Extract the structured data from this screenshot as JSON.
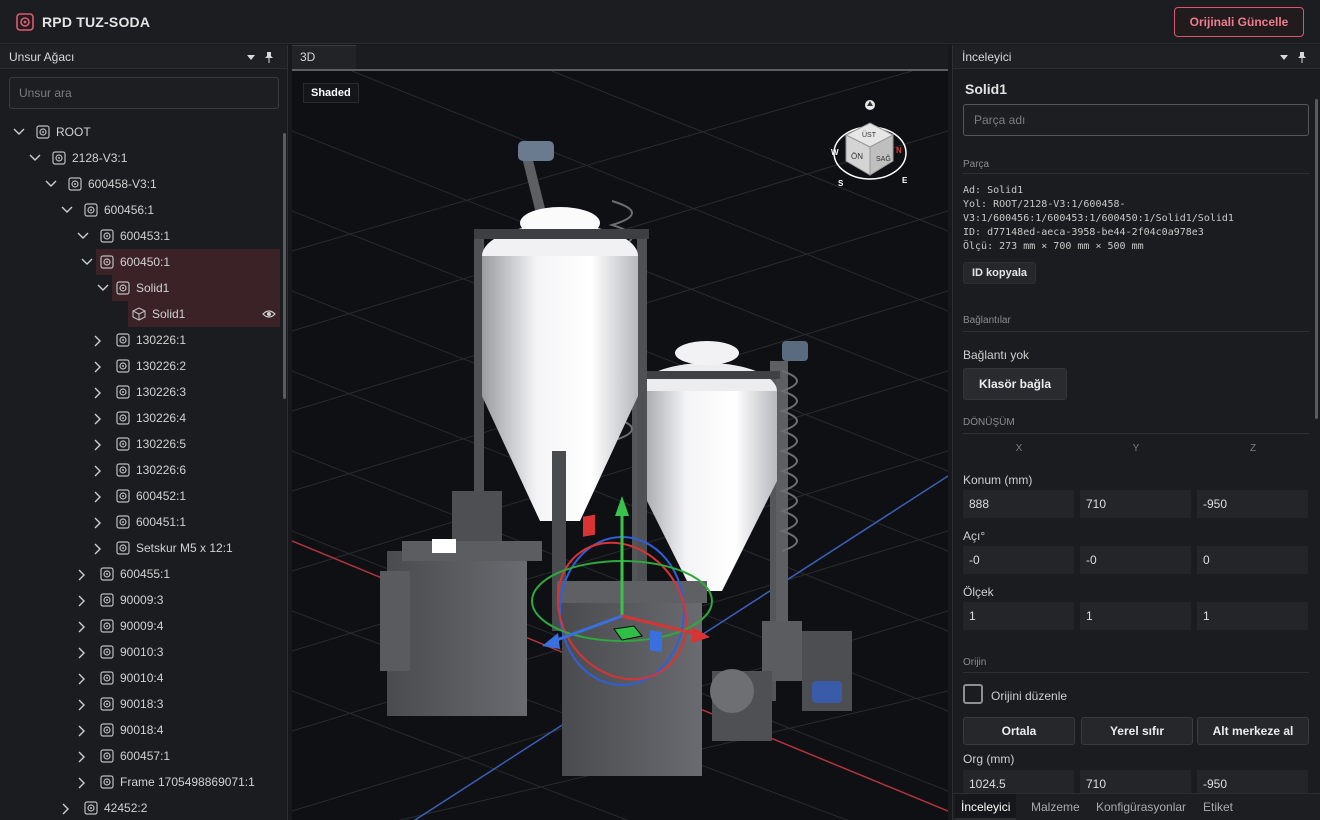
{
  "app": {
    "title": "RPD TUZ-SODA",
    "update_button": "Orijinali Güncelle"
  },
  "left_panel": {
    "title": "Unsur Ağacı",
    "search_placeholder": "Unsur ara",
    "tree": [
      {
        "label": "ROOT",
        "depth": 0,
        "expanded": true,
        "selected": false,
        "icon": "assembly-icon"
      },
      {
        "label": "2128-V3:1",
        "depth": 1,
        "expanded": true,
        "selected": false,
        "icon": "assembly-icon"
      },
      {
        "label": "600458-V3:1",
        "depth": 2,
        "expanded": true,
        "selected": false,
        "icon": "assembly-icon"
      },
      {
        "label": "600456:1",
        "depth": 3,
        "expanded": true,
        "selected": false,
        "icon": "assembly-icon"
      },
      {
        "label": "600453:1",
        "depth": 4,
        "expanded": true,
        "selected": false,
        "icon": "assembly-icon"
      },
      {
        "label": "600450:1",
        "depth": 5,
        "expanded": true,
        "selected": true,
        "icon": "assembly-icon"
      },
      {
        "label": "Solid1",
        "depth": 6,
        "expanded": true,
        "selected": true,
        "icon": "assembly-icon"
      },
      {
        "label": "Solid1",
        "depth": 7,
        "expanded": null,
        "selected": true,
        "icon": "cube-icon",
        "eye": true
      },
      {
        "label": "130226:1",
        "depth": 5,
        "expanded": false,
        "selected": false,
        "icon": "assembly-icon"
      },
      {
        "label": "130226:2",
        "depth": 5,
        "expanded": false,
        "selected": false,
        "icon": "assembly-icon"
      },
      {
        "label": "130226:3",
        "depth": 5,
        "expanded": false,
        "selected": false,
        "icon": "assembly-icon"
      },
      {
        "label": "130226:4",
        "depth": 5,
        "expanded": false,
        "selected": false,
        "icon": "assembly-icon"
      },
      {
        "label": "130226:5",
        "depth": 5,
        "expanded": false,
        "selected": false,
        "icon": "assembly-icon"
      },
      {
        "label": "130226:6",
        "depth": 5,
        "expanded": false,
        "selected": false,
        "icon": "assembly-icon"
      },
      {
        "label": "600452:1",
        "depth": 5,
        "expanded": false,
        "selected": false,
        "icon": "assembly-icon"
      },
      {
        "label": "600451:1",
        "depth": 5,
        "expanded": false,
        "selected": false,
        "icon": "assembly-icon"
      },
      {
        "label": "Setskur M5  x  12:1",
        "depth": 5,
        "expanded": false,
        "selected": false,
        "icon": "assembly-icon"
      },
      {
        "label": "600455:1",
        "depth": 4,
        "expanded": false,
        "selected": false,
        "icon": "assembly-icon"
      },
      {
        "label": "90009:3",
        "depth": 4,
        "expanded": false,
        "selected": false,
        "icon": "assembly-icon"
      },
      {
        "label": "90009:4",
        "depth": 4,
        "expanded": false,
        "selected": false,
        "icon": "assembly-icon"
      },
      {
        "label": "90010:3",
        "depth": 4,
        "expanded": false,
        "selected": false,
        "icon": "assembly-icon"
      },
      {
        "label": "90010:4",
        "depth": 4,
        "expanded": false,
        "selected": false,
        "icon": "assembly-icon"
      },
      {
        "label": "90018:3",
        "depth": 4,
        "expanded": false,
        "selected": false,
        "icon": "assembly-icon"
      },
      {
        "label": "90018:4",
        "depth": 4,
        "expanded": false,
        "selected": false,
        "icon": "assembly-icon"
      },
      {
        "label": "600457:1",
        "depth": 4,
        "expanded": false,
        "selected": false,
        "icon": "assembly-icon"
      },
      {
        "label": "Frame 1705498869071:1",
        "depth": 4,
        "expanded": false,
        "selected": false,
        "icon": "assembly-icon"
      },
      {
        "label": "42452:2",
        "depth": 3,
        "expanded": false,
        "selected": false,
        "icon": "assembly-icon"
      }
    ]
  },
  "viewport": {
    "tab": "3D",
    "shading": "Shaded",
    "view_cube": {
      "top": "ÜST",
      "front": "ÖN",
      "right": "SAĞ",
      "w": "W",
      "n": "N",
      "s": "S",
      "e": "E"
    }
  },
  "inspector": {
    "title": "İnceleyici",
    "part_name": "Solid1",
    "name_placeholder": "Parça adı",
    "section_part": "Parça",
    "info": {
      "ad": "Ad: Solid1",
      "yol1": "Yol: ROOT/2128-V3:1/600458-",
      "yol2": "V3:1/600456:1/600453:1/600450:1/Solid1/Solid1",
      "id": "ID: d77148ed-aeca-3958-be44-2f04c0a978e3",
      "olcu": "Ölçü: 273 mm × 700 mm × 500 mm"
    },
    "copy_id": "ID kopyala",
    "section_links": "Bağlantılar",
    "no_link": "Bağlantı yok",
    "link_button": "Klasör bağla",
    "section_transform": "DÖNÜŞÜM",
    "axes": [
      "X",
      "Y",
      "Z"
    ],
    "position_label": "Konum (mm)",
    "position": [
      "888",
      "710",
      "-950"
    ],
    "angle_label": "Açı°",
    "angle": [
      "-0",
      "-0",
      "0"
    ],
    "scale_label": "Ölçek",
    "scale": [
      "1",
      "1",
      "1"
    ],
    "section_origin": "Orijin",
    "edit_origin": "Orijini düzenle",
    "origin_buttons": [
      "Ortala",
      "Yerel sıfır",
      "Alt merkeze al"
    ],
    "org_label": "Org (mm)",
    "org": [
      "1024.5",
      "710",
      "-950"
    ]
  },
  "bottom_tabs": [
    "İnceleyici",
    "Malzeme",
    "Konfigürasyonlar",
    "Etiket"
  ],
  "colors": {
    "accent": "#d9566a",
    "selection": "#3a2226",
    "gizmo_x": "#e03b3b",
    "gizmo_y": "#3bbf4a",
    "gizmo_z": "#3a6fe0"
  }
}
